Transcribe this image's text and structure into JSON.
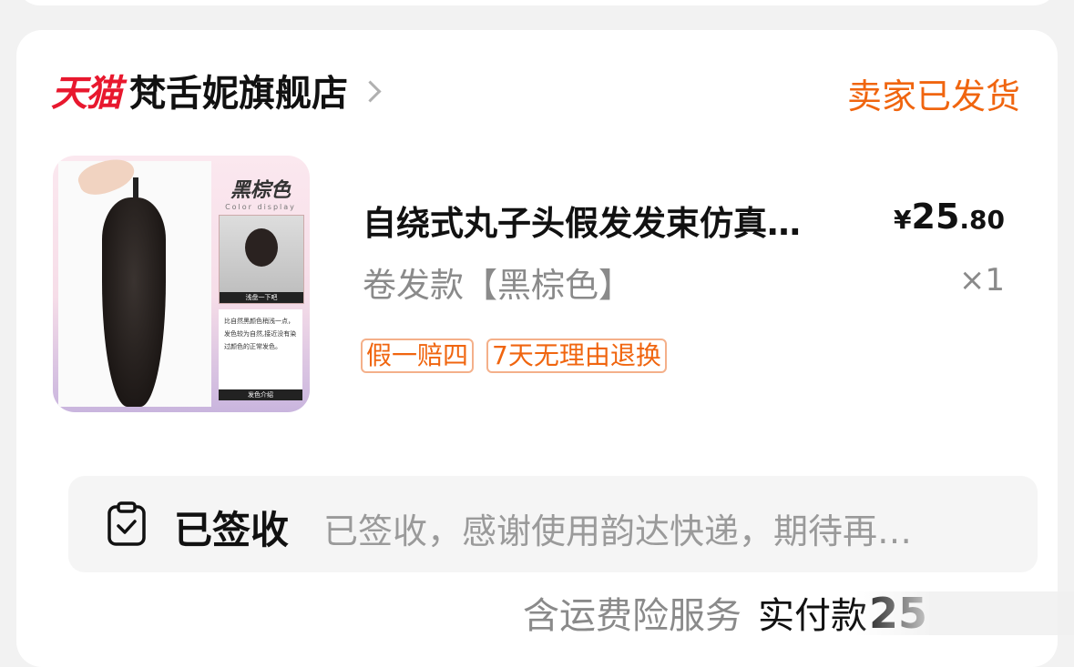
{
  "store": {
    "platform_logo": "天猫",
    "name": "梵舌妮旗舰店"
  },
  "order_status": "卖家已发货",
  "product": {
    "image_title": "黑棕色",
    "image_subtitle": "Color display",
    "image_photo_caption": "浅盘一下吧",
    "image_desc": "比自然黑颜色稍浅一点，发色较为自然,接近没有染过颜色的正常发色。",
    "image_desc_caption": "发色介绍",
    "title": "自绕式丸子头假发发束仿真…",
    "price_currency": "¥",
    "price_int": "25",
    "price_dec": ".80",
    "variant": "卷发款【黑棕色】",
    "quantity": "×1",
    "tags": [
      "假一赔四",
      "7天无理由退换"
    ]
  },
  "logistics": {
    "status": "已签收",
    "desc": "已签收，感谢使用韵达快递，期待再…"
  },
  "footer": {
    "insurance": "含运费险服务",
    "paid_label": "实付款",
    "paid_amount": "25"
  },
  "colors": {
    "tmall_red": "#e8182e",
    "status_orange": "#f0650f"
  }
}
